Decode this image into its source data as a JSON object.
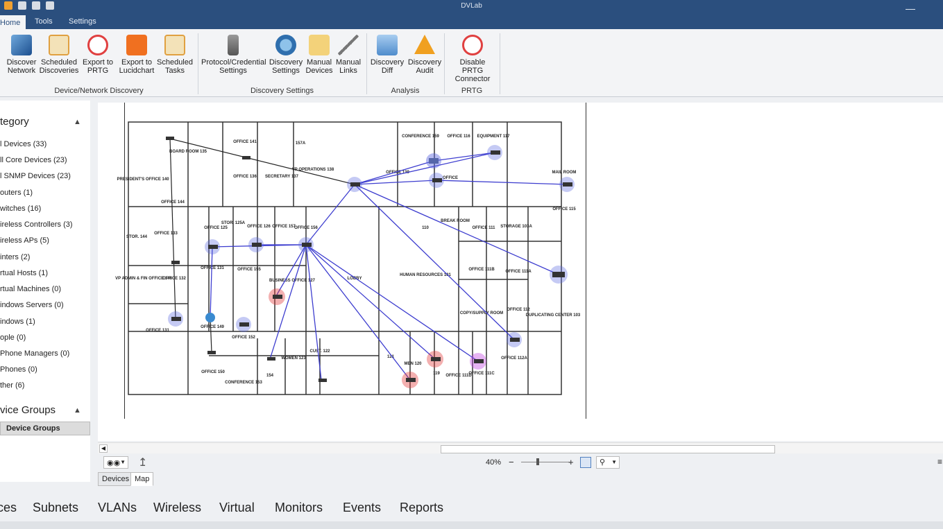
{
  "window": {
    "title": "DVLab"
  },
  "menu": {
    "tabs": [
      "Home",
      "Tools",
      "Settings"
    ]
  },
  "ribbon": {
    "groups": [
      {
        "label": "Device/Network Discovery"
      },
      {
        "label": "Discovery Settings"
      },
      {
        "label": "Analysis"
      },
      {
        "label": "PRTG"
      }
    ],
    "buttons": {
      "discover_network": [
        "Discover",
        "Network"
      ],
      "scheduled_discoveries": [
        "Scheduled",
        "Discoveries"
      ],
      "export_prtg": [
        "Export to",
        "PRTG"
      ],
      "export_lucidchart": [
        "Export to",
        "Lucidchart"
      ],
      "scheduled_tasks": [
        "Scheduled",
        "Tasks"
      ],
      "protocol_credential": [
        "Protocol/Credential",
        "Settings"
      ],
      "discovery_settings": [
        "Discovery",
        "Settings"
      ],
      "manual_devices": [
        "Manual",
        "Devices"
      ],
      "manual_links": [
        "Manual",
        "Links"
      ],
      "discovery_diff": [
        "Discovery",
        "Diff"
      ],
      "discovery_audit": [
        "Discovery",
        "Audit"
      ],
      "disable_prtg": [
        "Disable PRTG",
        "Connector"
      ]
    },
    "partial_left_label": "e"
  },
  "sidebar": {
    "category_heading": "tegory",
    "items": [
      "l Devices (33)",
      "ll Core Devices (23)",
      "l SNMP Devices (23)",
      "outers (1)",
      "witches (16)",
      "ireless Controllers (3)",
      "ireless APs (5)",
      "inters (2)",
      "rtual Hosts (1)",
      "rtual Machines (0)",
      "indows Servers (0)",
      "indows (1)",
      "ople (0)",
      " Phone Managers (0)",
      " Phones (0)",
      "ther (6)"
    ],
    "groups_heading": "vice Groups",
    "groups_row": "Device Groups"
  },
  "map": {
    "rooms": [
      "CONFERENCE 159",
      "OFFICE 116",
      "EQUIPMENT 117",
      "BOARD ROOM 135",
      "OFFICE 141",
      "157A",
      "VP OPERATIONS 138",
      "SECRETARY 137",
      "OFFICE 136",
      "PRESIDENT'S OFFICE 140",
      "OFFICE 144",
      "OFFICE 139",
      "OFFICE",
      "MAIL ROOM",
      "OFFICE 115",
      "STOR. 125A",
      "OFFICE 125",
      "OFFICE 157",
      "OFFICE 156",
      "OFFICE 126",
      "110",
      "BREAK ROOM",
      "OFFICE 111",
      "STORAGE 103A",
      "OFFICE 133",
      "STOR. 144",
      "OFFICE 131",
      "OFFICE 155",
      "BUSINESS OFFICE 127",
      "LOBBY",
      "HUMAN RESOURCES 101",
      "OFFICE 111B",
      "OFFICE 111A",
      "VP ADMIN & FIN OFFICE 146",
      "OFFICE 132",
      "OFFICE 112",
      "COPY/SUPPLY ROOM",
      "DUPLICATING CENTER 103",
      "OFFICE 131",
      "OFFICE 149",
      "OFFICE 152",
      "OFFICE 150",
      "CONFERENCE 153",
      "154",
      "WOMEN 123",
      "CUST. 122",
      "121",
      "MEN 120",
      "119",
      "OFFICE 111D",
      "OFFICE 111C",
      "OFFICE 112A"
    ]
  },
  "bottom_toolbar": {
    "zoom": "40%",
    "minus": "−",
    "plus": "+"
  },
  "subtabs": [
    "Devices",
    "Map"
  ],
  "bottom_nav": [
    "ces",
    "Subnets",
    "VLANs",
    "Wireless",
    "Virtual",
    "Monitors",
    "Events",
    "Reports"
  ],
  "colors": {
    "title_bar": "#2b4f7e",
    "link_line": "#3d3dcf",
    "device_halo": "#5a66e0",
    "alert_halo": "#e03a3a",
    "purple_halo": "#c040e0"
  }
}
